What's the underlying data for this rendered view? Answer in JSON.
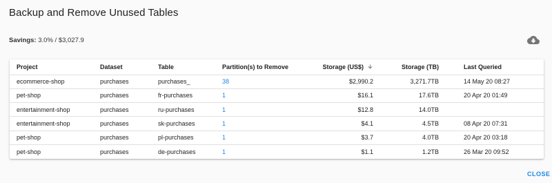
{
  "dialog": {
    "title": "Backup and Remove Unused Tables",
    "savings_label": "Savings:",
    "savings_value": "3.0% / $3,027.9",
    "download_icon": "cloud-download-icon",
    "close_label": "CLOSE"
  },
  "table": {
    "columns": {
      "project": "Project",
      "dataset": "Dataset",
      "table": "Table",
      "partitions": "Partition(s) to Remove",
      "storage_usd": "Storage (US$)",
      "storage_tb": "Storage (TB)",
      "last_queried": "Last Queried"
    },
    "sort": {
      "column": "storage_usd",
      "direction": "descending",
      "icon": "arrow-down-icon"
    },
    "rows": [
      {
        "project": "ecommerce-shop",
        "dataset": "purchases",
        "table": "purchases_",
        "partitions": "38",
        "storage_usd": "$2,990.2",
        "storage_tb": "3,271.7TB",
        "last_queried": "14 May 20 08:27"
      },
      {
        "project": "pet-shop",
        "dataset": "purchases",
        "table": "fr-purchases",
        "partitions": "1",
        "storage_usd": "$16.1",
        "storage_tb": "17.6TB",
        "last_queried": "20 Apr 20 01:49"
      },
      {
        "project": "entertainment-shop",
        "dataset": "purchases",
        "table": "ru-purchases",
        "partitions": "1",
        "storage_usd": "$12.8",
        "storage_tb": "14.0TB",
        "last_queried": ""
      },
      {
        "project": "entertainment-shop",
        "dataset": "purchases",
        "table": "sk-purchases",
        "partitions": "1",
        "storage_usd": "$4.1",
        "storage_tb": "4.5TB",
        "last_queried": "08 Apr 20 07:31"
      },
      {
        "project": "pet-shop",
        "dataset": "purchases",
        "table": "pl-purchases",
        "partitions": "1",
        "storage_usd": "$3.7",
        "storage_tb": "4.0TB",
        "last_queried": "20 Apr 20 03:18"
      },
      {
        "project": "pet-shop",
        "dataset": "purchases",
        "table": "de-purchases",
        "partitions": "1",
        "storage_usd": "$1.1",
        "storage_tb": "1.2TB",
        "last_queried": "26 Mar 20 09:52"
      }
    ]
  },
  "colors": {
    "link": "#1e88e5",
    "icon": "#757575",
    "divider": "#e0e0e0",
    "background": "#fafafa",
    "card": "#ffffff"
  }
}
